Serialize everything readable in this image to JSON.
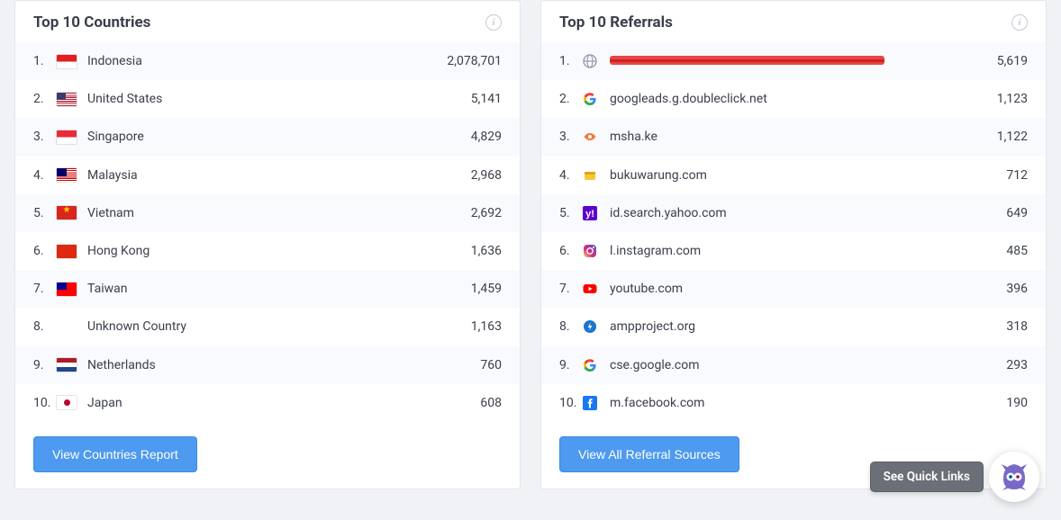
{
  "countries_panel": {
    "title": "Top 10 Countries",
    "button_label": "View Countries Report",
    "rows": [
      {
        "rank": "1.",
        "flag": "id",
        "name": "Indonesia",
        "value": "2,078,701"
      },
      {
        "rank": "2.",
        "flag": "us",
        "name": "United States",
        "value": "5,141"
      },
      {
        "rank": "3.",
        "flag": "sg",
        "name": "Singapore",
        "value": "4,829"
      },
      {
        "rank": "4.",
        "flag": "my",
        "name": "Malaysia",
        "value": "2,968"
      },
      {
        "rank": "5.",
        "flag": "vn",
        "name": "Vietnam",
        "value": "2,692"
      },
      {
        "rank": "6.",
        "flag": "hk",
        "name": "Hong Kong",
        "value": "1,636"
      },
      {
        "rank": "7.",
        "flag": "tw",
        "name": "Taiwan",
        "value": "1,459"
      },
      {
        "rank": "8.",
        "flag": "unknown",
        "name": "Unknown Country",
        "value": "1,163"
      },
      {
        "rank": "9.",
        "flag": "nl",
        "name": "Netherlands",
        "value": "760"
      },
      {
        "rank": "10.",
        "flag": "jp",
        "name": "Japan",
        "value": "608"
      }
    ]
  },
  "referrals_panel": {
    "title": "Top 10 Referrals",
    "button_label": "View All Referral Sources",
    "rows": [
      {
        "rank": "1.",
        "icon": "globe",
        "name": "[redacted].cdn.ampproject.org",
        "redacted": true,
        "value": "5,619"
      },
      {
        "rank": "2.",
        "icon": "google",
        "name": "googleads.g.doubleclick.net",
        "value": "1,123"
      },
      {
        "rank": "3.",
        "icon": "eye",
        "name": "msha.ke",
        "value": "1,122"
      },
      {
        "rank": "4.",
        "icon": "warung",
        "name": "bukuwarung.com",
        "value": "712"
      },
      {
        "rank": "5.",
        "icon": "yahoo",
        "name": "id.search.yahoo.com",
        "value": "649"
      },
      {
        "rank": "6.",
        "icon": "instagram",
        "name": "l.instagram.com",
        "value": "485"
      },
      {
        "rank": "7.",
        "icon": "youtube",
        "name": "youtube.com",
        "value": "396"
      },
      {
        "rank": "8.",
        "icon": "amp",
        "name": "ampproject.org",
        "value": "318"
      },
      {
        "rank": "9.",
        "icon": "google",
        "name": "cse.google.com",
        "value": "293"
      },
      {
        "rank": "10.",
        "icon": "facebook",
        "name": "m.facebook.com",
        "value": "190"
      }
    ]
  },
  "quick_links": {
    "label": "See Quick Links"
  }
}
